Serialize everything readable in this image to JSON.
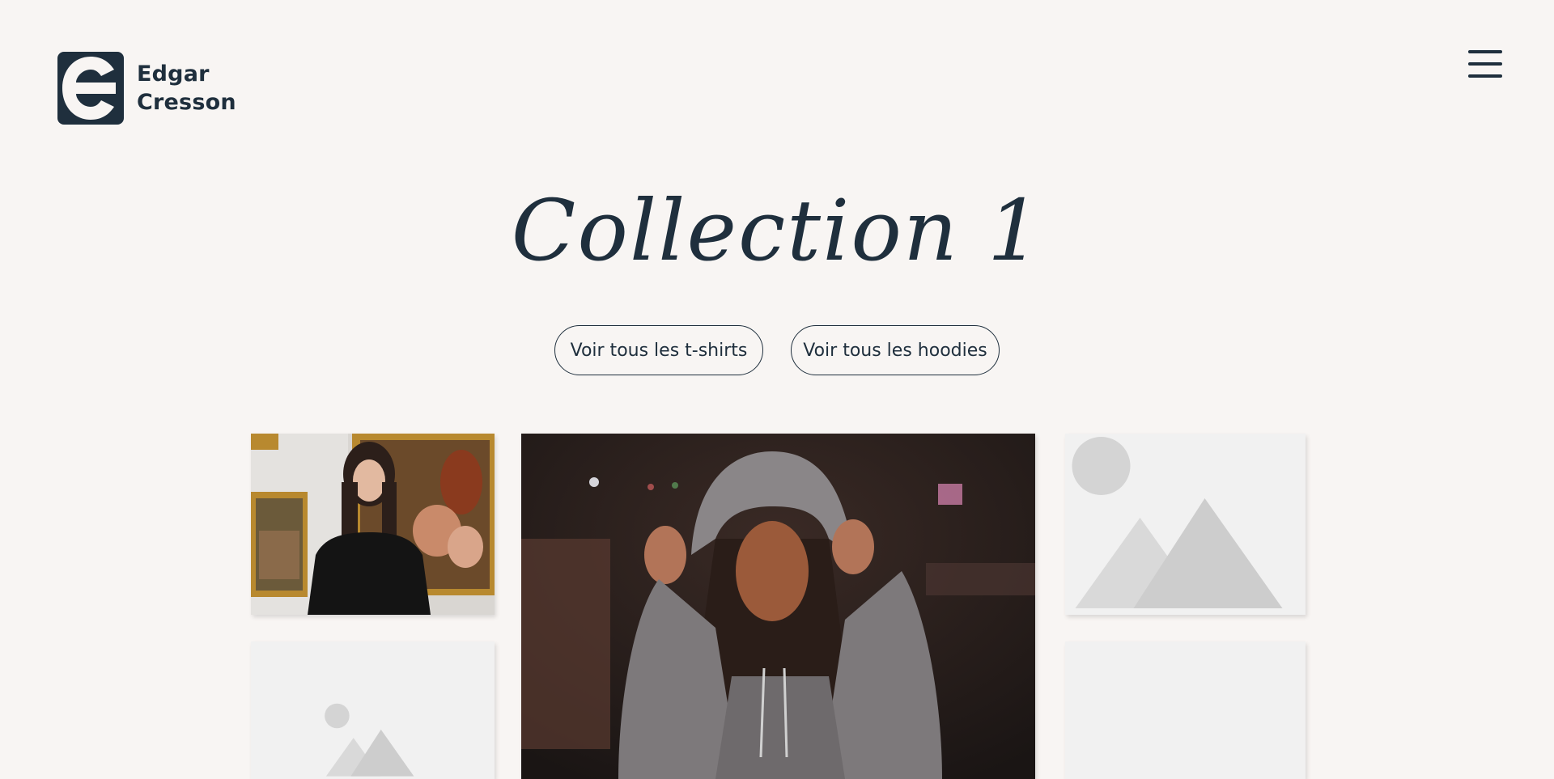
{
  "header": {
    "brand_line1": "Edgar",
    "brand_line2": "Cresson",
    "menu_icon": "hamburger-icon"
  },
  "main": {
    "title": "Collection 1",
    "buttons": [
      {
        "label": "Voir tous les t-shirts"
      },
      {
        "label": "Voir tous les hoodies"
      }
    ]
  },
  "gallery": {
    "items": [
      {
        "type": "photo",
        "subject": "woman in black t-shirt in art gallery"
      },
      {
        "type": "photo",
        "subject": "woman in grey hoodie at night"
      },
      {
        "type": "placeholder",
        "icon": "image-placeholder-icon"
      },
      {
        "type": "placeholder",
        "icon": "image-placeholder-icon"
      },
      {
        "type": "placeholder",
        "icon": "image-placeholder-icon"
      }
    ]
  },
  "colors": {
    "background": "#f8f5f3",
    "primary": "#1f2f3d",
    "placeholder_bg": "#f1f1f1"
  }
}
